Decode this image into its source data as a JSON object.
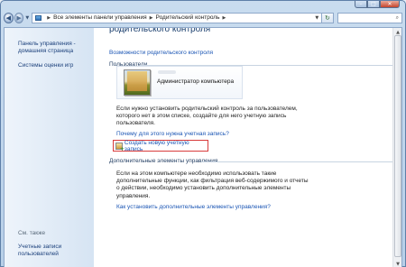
{
  "window": {
    "controls": {
      "minimize": "–",
      "maximize": "□",
      "close": "✕"
    }
  },
  "navbar": {
    "back_glyph": "◀",
    "forward_glyph": "▶",
    "breadcrumb": [
      "Все элементы панели управления",
      "Родительский контроль"
    ],
    "refresh_glyph": "↻",
    "search_placeholder": "",
    "search_glyph": "⌕"
  },
  "sidebar": {
    "links": [
      "Панель управления -",
      "домашняя страница",
      "Системы оценки игр"
    ],
    "see_also_title": "См. также",
    "see_also_links": [
      "Учетные записи",
      "пользователей"
    ]
  },
  "content": {
    "page_heading_partial": "родительского контроля",
    "features_link": "Возможности родительского контроля",
    "users_section": "Пользователи",
    "user_name": "Администратор компьютера",
    "info_text": [
      "Если нужно установить родительский контроль за пользователем,",
      "которого нет в этом списке, создайте для него учетную запись",
      "пользователя."
    ],
    "why_link": "Почему для этого нужна учетная запись?",
    "create_account_link": "Создать новую учетную запись",
    "additional_section": "Дополнительные элементы управления",
    "additional_text": [
      "Если на этом компьютере необходимо использовать такие",
      "дополнительные функции, как фильтрация веб-содержимого и отчеты",
      "о действии, необходимо установить дополнительные элементы",
      "управления."
    ],
    "install_link": "Как установить дополнительные элементы управления?"
  },
  "colors": {
    "link": "#1a55b4",
    "highlight_border": "#d83b3b",
    "sidebar_bg": "#d6e4f3"
  }
}
